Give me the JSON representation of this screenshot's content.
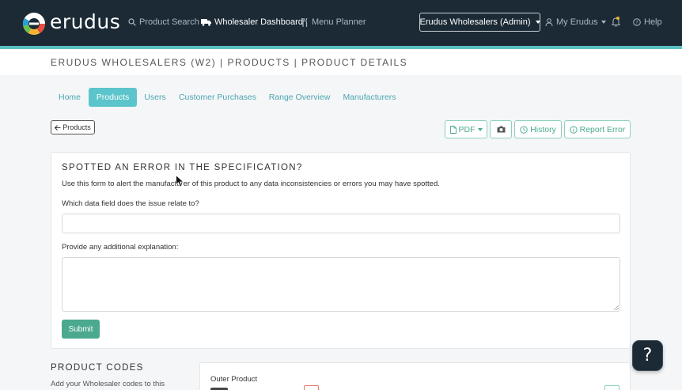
{
  "navbar": {
    "brand": "erudus",
    "links": [
      {
        "label": "Product Search",
        "icon": "search-icon"
      },
      {
        "label": "Wholesaler Dashboard",
        "icon": "truck-icon",
        "active": true
      },
      {
        "label": "Menu Planner",
        "icon": "cutlery-icon"
      }
    ],
    "account_dropdown": "Erudus Wholesalers (Admin)",
    "my_account": "My Erudus",
    "help": "Help",
    "colors": {
      "bar": "#1b2a35",
      "accent": "#5bc0c4"
    }
  },
  "breadcrumb": "ERUDUS WHOLESALERS (W2) | PRODUCTS | PRODUCT DETAILS",
  "tabs": [
    {
      "label": "Home"
    },
    {
      "label": "Products",
      "active": true
    },
    {
      "label": "Users"
    },
    {
      "label": "Customer Purchases"
    },
    {
      "label": "Range Overview"
    },
    {
      "label": "Manufacturers"
    }
  ],
  "back_button": "Products",
  "toolbar": {
    "pdf": "PDF",
    "camera_icon": "camera-icon",
    "history": "History",
    "report_error": "Report Error"
  },
  "report_form": {
    "title": "SPOTTED AN ERROR IN THE SPECIFICATION?",
    "description": "Use this form to alert the manufacturer of this product to any data inconsistencies or errors you may have spotted.",
    "field_label": "Which data field does the issue relate to?",
    "field_value": "",
    "explanation_label": "Provide any additional explanation:",
    "explanation_value": "",
    "submit": "Submit"
  },
  "product_codes": {
    "title": "PRODUCT CODES",
    "description": "Add your Wholesaler codes to this",
    "outer_label": "Outer Product"
  },
  "help_fab": "?"
}
